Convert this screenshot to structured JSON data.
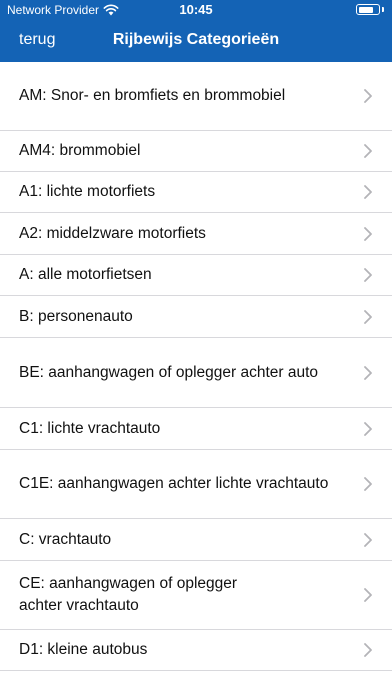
{
  "status_bar": {
    "carrier": "Network Provider",
    "time": "10:45",
    "battery_level": 0.75
  },
  "nav": {
    "back_label": "terug",
    "title": "Rijbewijs Categorieën"
  },
  "categories": [
    {
      "label": "AM: Snor- en bromfiets en brommobiel",
      "lines": [
        "AM: Snor- en bromfiets en brommobiel"
      ]
    },
    {
      "label": "AM4: brommobiel",
      "lines": [
        "AM4: brommobiel"
      ]
    },
    {
      "label": "A1: lichte motorfiets",
      "lines": [
        "A1: lichte motorfiets"
      ]
    },
    {
      "label": "A2: middelzware motorfiets",
      "lines": [
        "A2: middelzware motorfiets"
      ]
    },
    {
      "label": "A: alle motorfietsen",
      "lines": [
        "A: alle motorfietsen"
      ]
    },
    {
      "label": "B: personenauto",
      "lines": [
        "B: personenauto"
      ]
    },
    {
      "label": "BE: aanhangwagen of oplegger achter auto",
      "lines": [
        "BE: aanhangwagen of oplegger achter auto"
      ]
    },
    {
      "label": "C1: lichte vrachtauto",
      "lines": [
        "C1: lichte vrachtauto"
      ]
    },
    {
      "label": "C1E: aanhangwagen achter lichte vrachtauto",
      "lines": [
        "C1E: aanhangwagen achter lichte vrachtauto"
      ]
    },
    {
      "label": "C: vrachtauto",
      "lines": [
        "C: vrachtauto"
      ]
    },
    {
      "label": "CE: aanhangwagen of oplegger achter vrachtauto",
      "lines": [
        "CE: aanhangwagen of oplegger",
        "achter vrachtauto"
      ]
    },
    {
      "label": "D1: kleine autobus",
      "lines": [
        "D1: kleine autobus"
      ]
    }
  ]
}
